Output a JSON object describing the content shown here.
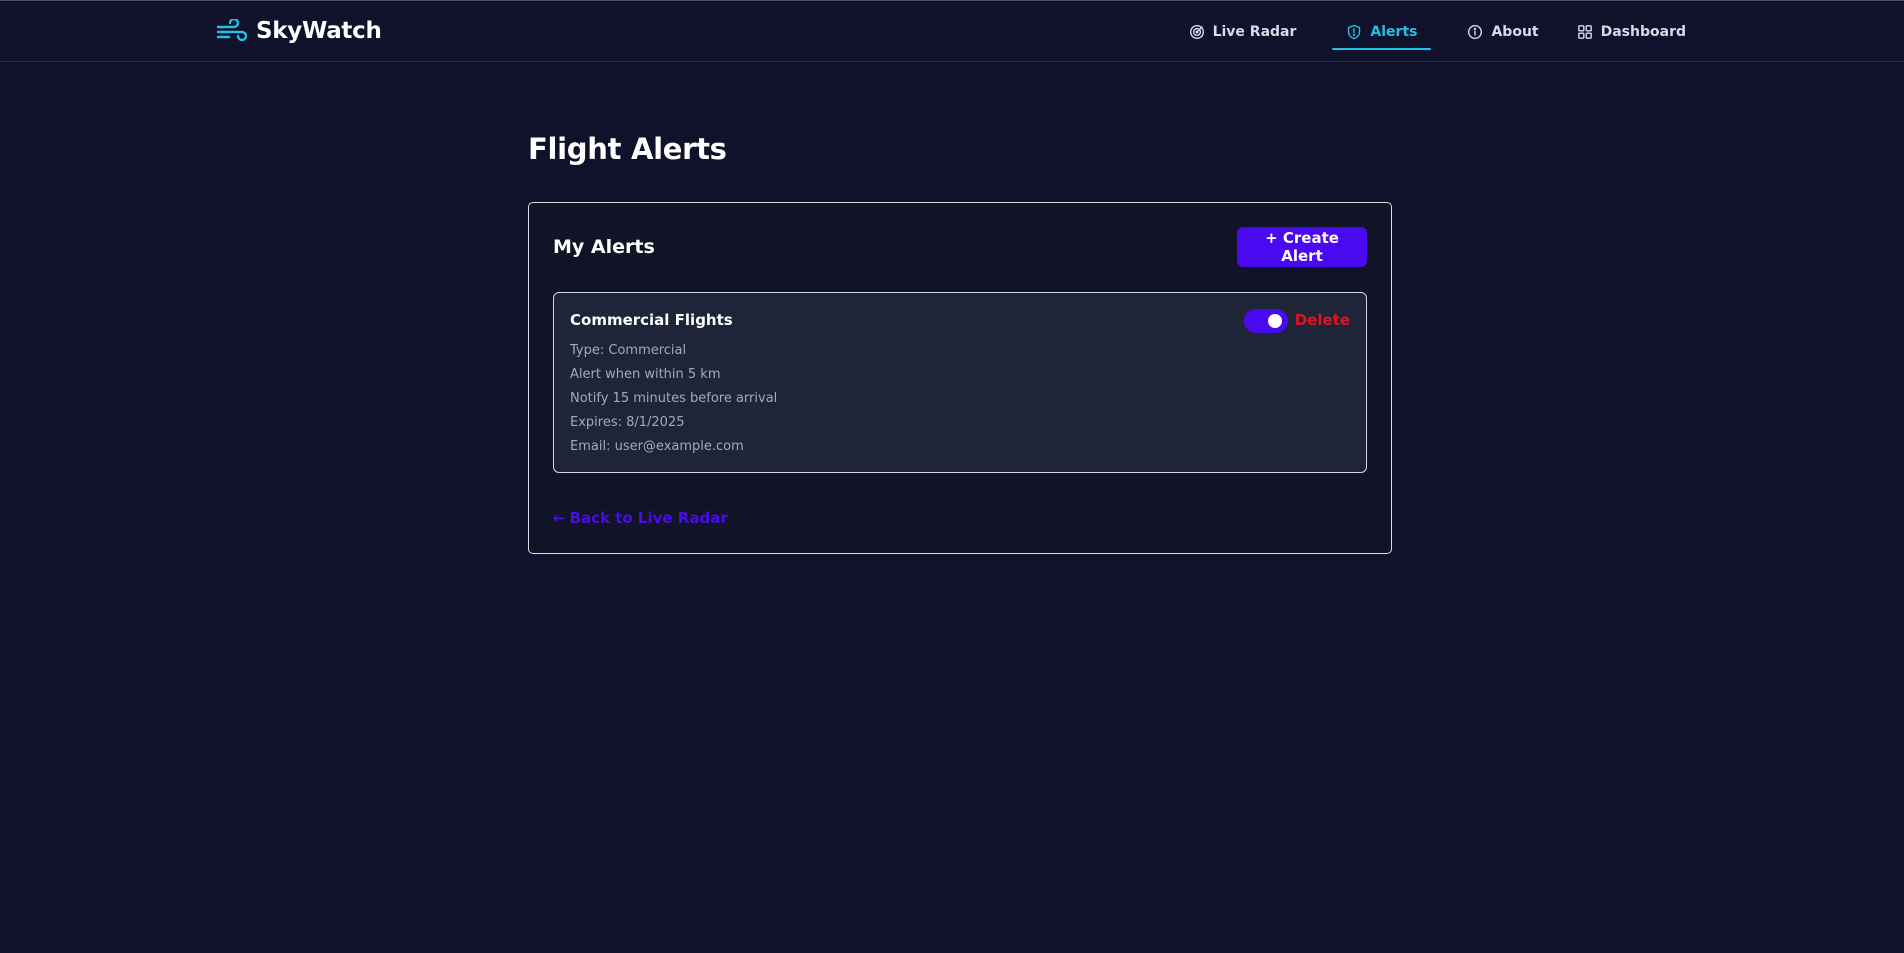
{
  "brand": {
    "name": "SkyWatch",
    "icon": "wind-icon",
    "accent_color": "#22c0e4"
  },
  "nav": {
    "items": [
      {
        "label": "Live Radar",
        "icon": "radar-icon",
        "active": false
      },
      {
        "label": "Alerts",
        "icon": "shield-icon",
        "active": true
      },
      {
        "label": "About",
        "icon": "info-icon",
        "active": false
      },
      {
        "label": "Dashboard",
        "icon": "grid-icon",
        "active": false
      }
    ]
  },
  "page": {
    "title": "Flight Alerts"
  },
  "alerts_panel": {
    "heading": "My Alerts",
    "create_label": "+ Create Alert",
    "button_color": "#4a0af0",
    "alerts": [
      {
        "name": "Commercial Flights",
        "enabled": true,
        "delete_label": "Delete",
        "details": [
          "Type: Commercial",
          "Alert when within 5 km",
          "Notify 15 minutes before arrival",
          "Expires: 8/1/2025",
          "Email: user@example.com"
        ]
      }
    ],
    "back_label": "Back to Live Radar",
    "back_icon": "arrow-left-icon"
  }
}
